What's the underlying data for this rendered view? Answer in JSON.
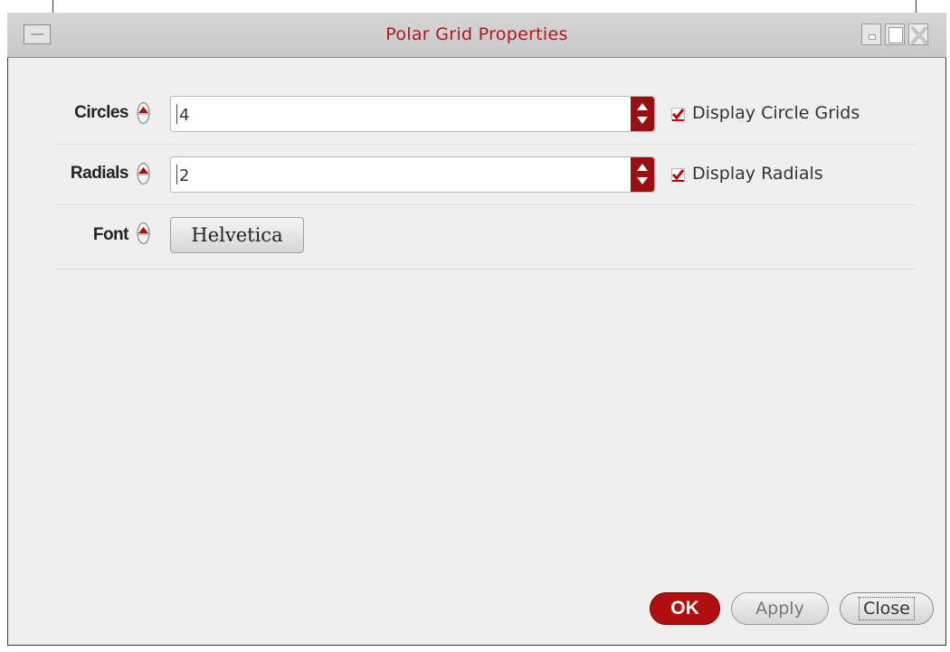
{
  "window": {
    "title": "Polar Grid Properties",
    "title_color": "#b01818",
    "controls": [
      "window-menu-icon",
      "minimize-icon",
      "maximize-icon",
      "close-icon"
    ]
  },
  "fields": {
    "circles": {
      "label": "Circles",
      "value": "4",
      "checkbox_label": "Display Circle Grids",
      "checked": true
    },
    "radials": {
      "label": "Radials",
      "value": "2",
      "checkbox_label": "Display Radials",
      "checked": true
    },
    "font": {
      "label": "Font",
      "button_label": "Helvetica"
    }
  },
  "buttons": {
    "ok": "OK",
    "apply": "Apply",
    "close": "Close"
  },
  "colors": {
    "accent": "#b10f0f",
    "background": "#efefef"
  }
}
